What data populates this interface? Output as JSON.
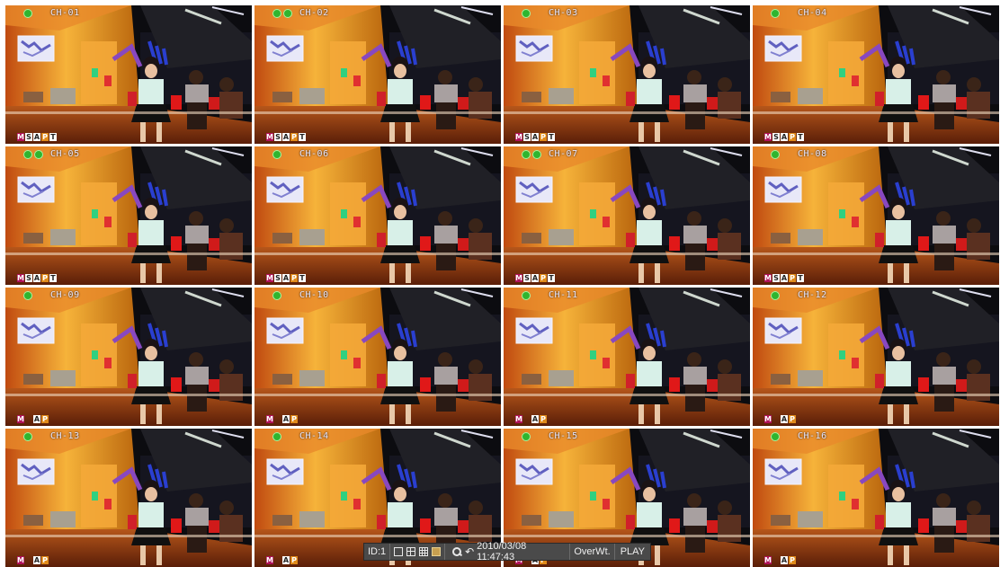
{
  "channels": [
    {
      "label": "CH-01",
      "dots": 1,
      "indicators": [
        "M",
        "S",
        "A",
        "P",
        "T"
      ]
    },
    {
      "label": "CH-02",
      "dots": 2,
      "indicators": [
        "M",
        "S",
        "A",
        "P",
        "T"
      ]
    },
    {
      "label": "CH-03",
      "dots": 1,
      "indicators": [
        "M",
        "S",
        "A",
        "P",
        "T"
      ]
    },
    {
      "label": "CH-04",
      "dots": 1,
      "indicators": [
        "M",
        "S",
        "A",
        "P",
        "T"
      ]
    },
    {
      "label": "CH-05",
      "dots": 2,
      "indicators": [
        "M",
        "S",
        "A",
        "P",
        "T"
      ]
    },
    {
      "label": "CH-06",
      "dots": 1,
      "indicators": [
        "M",
        "S",
        "A",
        "P",
        "T"
      ]
    },
    {
      "label": "CH-07",
      "dots": 2,
      "indicators": [
        "M",
        "S",
        "A",
        "P",
        "T"
      ]
    },
    {
      "label": "CH-08",
      "dots": 1,
      "indicators": [
        "M",
        "S",
        "A",
        "P",
        "T"
      ]
    },
    {
      "label": "CH-09",
      "dots": 1,
      "indicators": [
        "M",
        "A",
        "P"
      ]
    },
    {
      "label": "CH-10",
      "dots": 1,
      "indicators": [
        "M",
        "A",
        "P"
      ]
    },
    {
      "label": "CH-11",
      "dots": 1,
      "indicators": [
        "M",
        "A",
        "P"
      ]
    },
    {
      "label": "CH-12",
      "dots": 1,
      "indicators": [
        "M",
        "A",
        "P"
      ]
    },
    {
      "label": "CH-13",
      "dots": 1,
      "indicators": [
        "M",
        "A",
        "P"
      ]
    },
    {
      "label": "CH-14",
      "dots": 1,
      "indicators": [
        "M",
        "A",
        "P"
      ]
    },
    {
      "label": "CH-15",
      "dots": 1,
      "indicators": [
        "M",
        "A",
        "P"
      ]
    },
    {
      "label": "CH-16",
      "dots": 1,
      "indicators": [
        "M",
        "A",
        "P"
      ]
    }
  ],
  "statusbar": {
    "id_label": "ID:1",
    "layout_icons": [
      "single-view-icon",
      "quad-view-icon",
      "nine-view-icon",
      "sixteen-view-icon"
    ],
    "datetime": "2010/03/08 11:47:43",
    "mode": "OverWt.",
    "playback": "PLAY"
  },
  "colors": {
    "motion": "#b0125a",
    "play": "#e08a1a",
    "camera_ok": "#2fb52f",
    "status_bg": "#4a4a4a"
  }
}
